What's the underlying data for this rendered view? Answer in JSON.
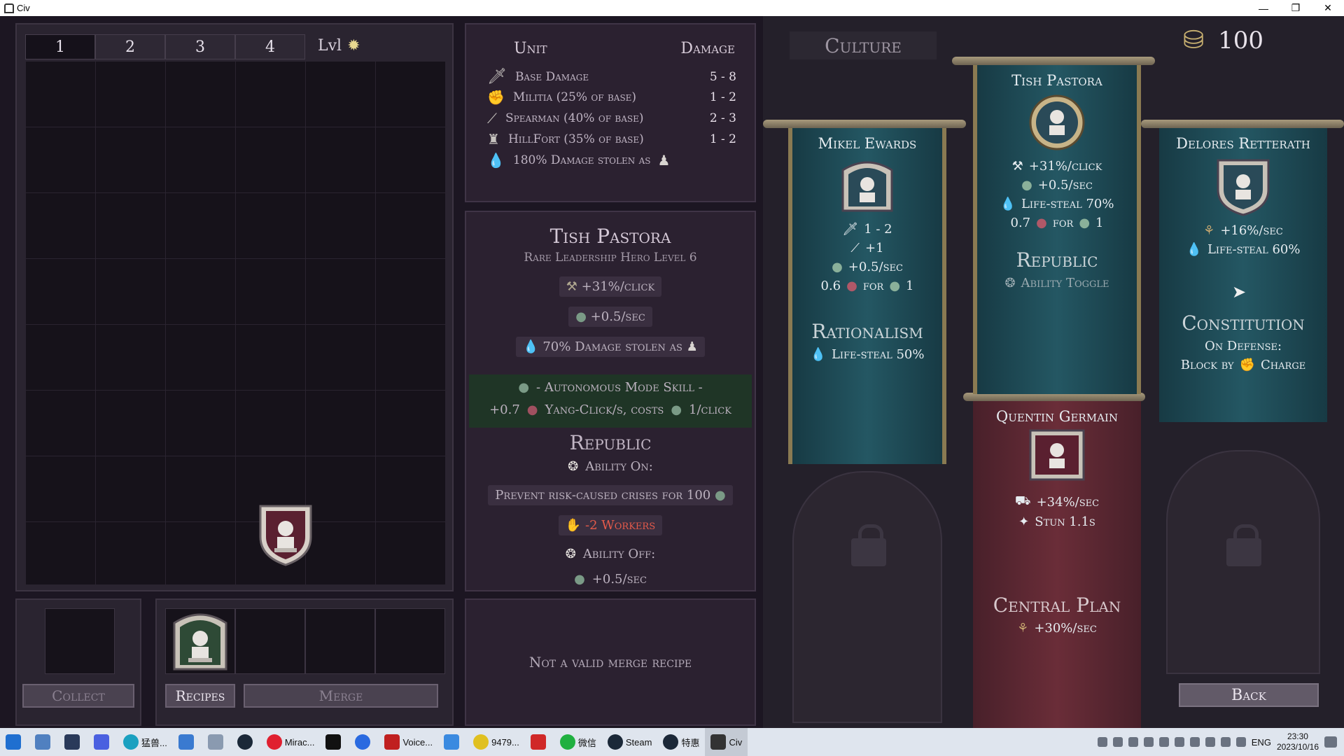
{
  "window": {
    "title": "Civ",
    "buttons": [
      "—",
      "❐",
      "✕"
    ]
  },
  "grid": {
    "tabs": [
      "1",
      "2",
      "3",
      "4"
    ],
    "level_label": "Lvl"
  },
  "bottom_left": {
    "collect_label": "Collect",
    "recipes_label": "Recipes",
    "merge_label": "Merge"
  },
  "stats": {
    "header_unit": "Unit",
    "header_damage": "Damage",
    "rows": [
      {
        "name": "Base Damage",
        "value": "5 - 8",
        "icon": "sword-icon"
      },
      {
        "name": "Militia (25% of base)",
        "value": "1 - 2",
        "icon": "fist-icon"
      },
      {
        "name": "Spearman (40% of base)",
        "value": "2 - 3",
        "icon": "spear-icon"
      },
      {
        "name": "HillFort (35% of base)",
        "value": "1 - 2",
        "icon": "fort-icon"
      },
      {
        "name": "180% Damage stolen as",
        "value": "",
        "icon": "blood-drop-icon"
      }
    ]
  },
  "hero": {
    "name": "Tish Pastora",
    "subtitle": "Rare Leadership Hero Level 6",
    "click_bonus": "+31%/click",
    "sec_bonus": "+0.5/sec",
    "steal_line": "70% Damage stolen as",
    "auto_line1": "- Autonomous Mode Skill -",
    "auto_amount": "+0.7",
    "auto_line2": "Yang-Click/s, costs",
    "auto_cost": "1/click",
    "government": "Republic",
    "ability_on": "Ability On:",
    "prevent": "Prevent risk-caused crises for 100",
    "workers": "-2 Workers",
    "ability_off": "Ability Off:",
    "off_bonus": "+0.5/sec"
  },
  "merge_message": "Not a valid merge recipe",
  "culture": {
    "title": "Culture",
    "coins": "100",
    "back_label": "Back",
    "banners": {
      "mikel": {
        "name": "Mikel Ewards",
        "line1": "1 - 2",
        "line2": "+1",
        "line3": "+0.5/sec",
        "line4_a": "0.6",
        "line4_b": "for",
        "line4_c": "1",
        "title": "Rationalism",
        "title_line": "Life-steal 50%"
      },
      "tish": {
        "name": "Tish Pastora",
        "line1": "+31%/click",
        "line2": "+0.5/sec",
        "line3": "Life-steal 70%",
        "line4_a": "0.7",
        "line4_b": "for",
        "line4_c": "1",
        "title": "Republic",
        "title_line": "Ability Toggle"
      },
      "delores": {
        "name": "Delores Retterath",
        "line1": "+16%/sec",
        "line2": "Life-steal 60%",
        "title": "Constitution",
        "title_line1": "On Defense:",
        "title_line2_a": "Block by",
        "title_line2_b": "Charge"
      },
      "quentin": {
        "name": "Quentin Germain",
        "line1": "+34%/sec",
        "line2": "Stun 1.1s",
        "title": "Central Plan",
        "title_line": "+30%/sec"
      }
    }
  },
  "taskbar": {
    "items": [
      {
        "label": "",
        "icon": "windows-start-icon"
      },
      {
        "label": "",
        "icon": "calculator-icon"
      },
      {
        "label": "",
        "icon": "u-app-icon"
      },
      {
        "label": "",
        "icon": "browser-icon"
      },
      {
        "label": "猛兽...",
        "icon": "edge-icon"
      },
      {
        "label": "",
        "icon": "window-icon"
      },
      {
        "label": "",
        "icon": "photo-icon"
      },
      {
        "label": "",
        "icon": "steam-icon"
      },
      {
        "label": "Mirac...",
        "icon": "netease-icon"
      },
      {
        "label": "",
        "icon": "tiktok-icon"
      },
      {
        "label": "",
        "icon": "k-app-icon"
      },
      {
        "label": "Voice...",
        "icon": "voice-icon"
      },
      {
        "label": "",
        "icon": "arrow-app-icon"
      },
      {
        "label": "9479...",
        "icon": "face-app-icon"
      },
      {
        "label": "",
        "icon": "wps-icon"
      },
      {
        "label": "微信",
        "icon": "wechat-icon"
      },
      {
        "label": "Steam",
        "icon": "steam-icon"
      },
      {
        "label": "特惠",
        "icon": "steam-icon"
      },
      {
        "label": "Civ",
        "icon": "civ-icon"
      }
    ],
    "lang": "ENG",
    "time": "23:30",
    "date": "2023/10/16"
  },
  "colors": {
    "teal_banner": "#245763",
    "red_banner": "#6a2d38",
    "panel": "#2b2130",
    "red_text": "#e45a4a"
  }
}
